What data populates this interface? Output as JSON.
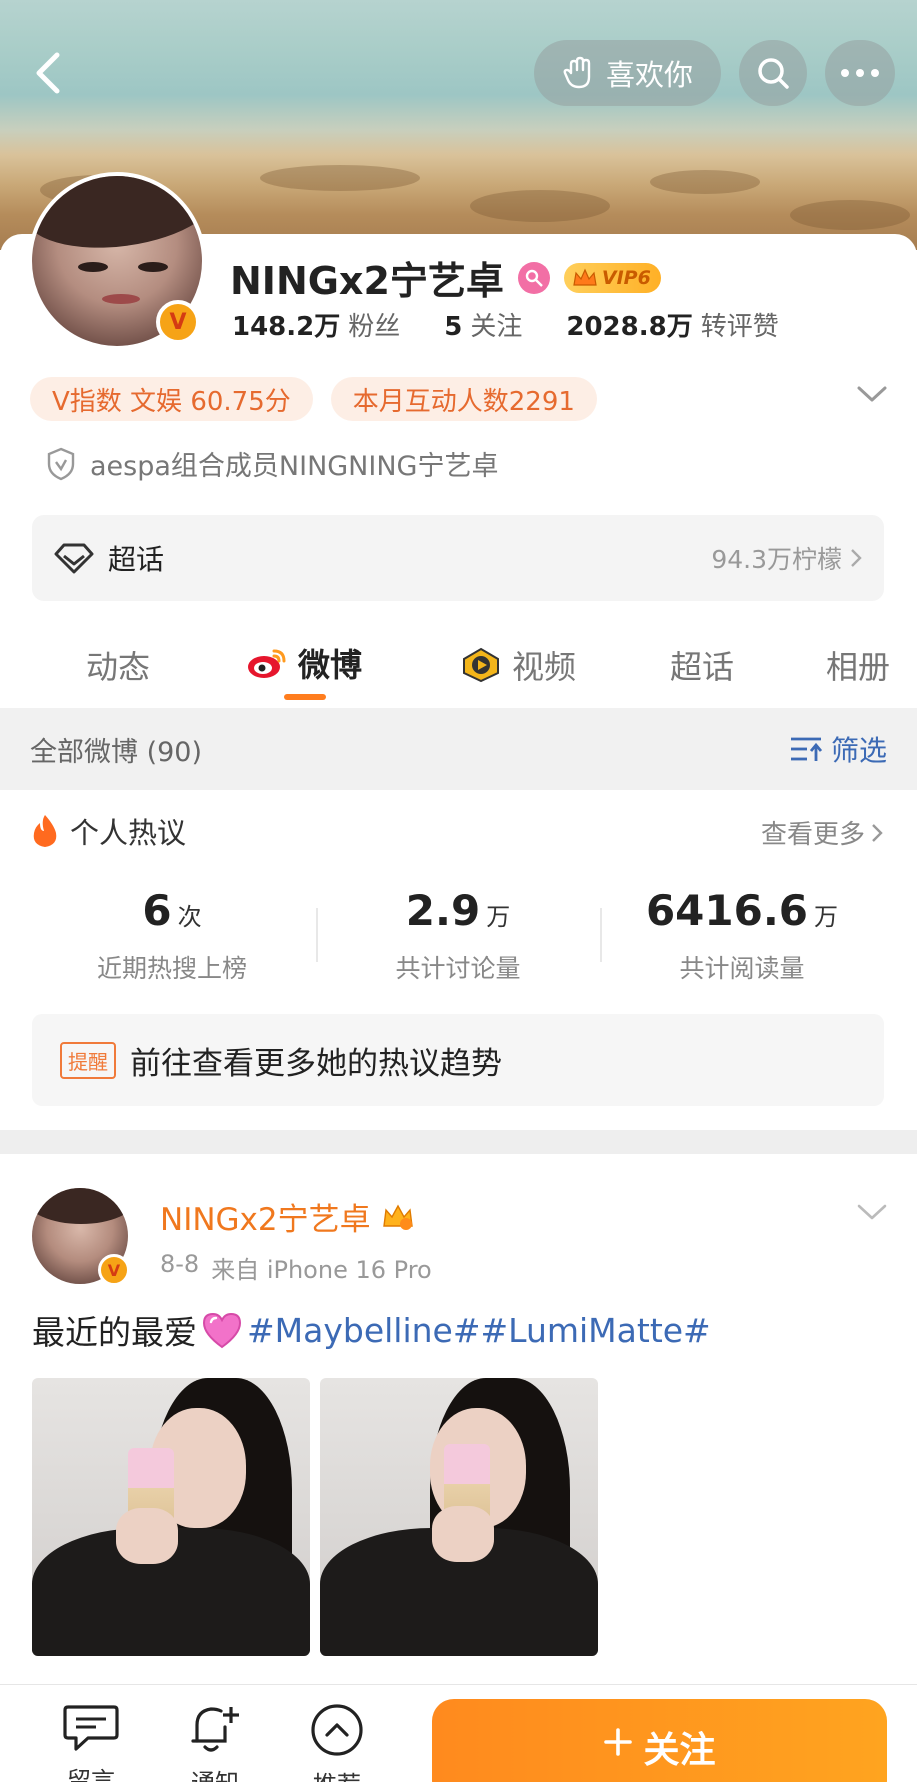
{
  "header": {
    "like_label": "喜欢你"
  },
  "profile": {
    "name": "NINGx2宁艺卓",
    "vip_label": "VIP6",
    "stats": [
      {
        "value": "148.2万",
        "label": "粉丝"
      },
      {
        "value": "5",
        "label": "关注"
      },
      {
        "value": "2028.8万",
        "label": "转评赞"
      }
    ],
    "chips": [
      "V指数 文娱 60.75分",
      "本月互动人数2291"
    ],
    "certification": "aespa组合成员NINGNING宁艺卓",
    "supertopic": {
      "label": "超话",
      "count": "94.3万柠檬"
    }
  },
  "tabs": [
    {
      "label": "动态",
      "active": false
    },
    {
      "label": "微博",
      "active": true
    },
    {
      "label": "视频",
      "active": false
    },
    {
      "label": "超话",
      "active": false
    },
    {
      "label": "相册",
      "active": false
    }
  ],
  "filter_bar": {
    "all_label": "全部微博 (90)",
    "filter_label": "筛选"
  },
  "hot": {
    "title": "个人热议",
    "more_label": "查看更多",
    "stats": [
      {
        "num": "6",
        "unit": "次",
        "label": "近期热搜上榜"
      },
      {
        "num": "2.9",
        "unit": "万",
        "label": "共计讨论量"
      },
      {
        "num": "6416.6",
        "unit": "万",
        "label": "共计阅读量"
      }
    ],
    "reminder_tag": "提醒",
    "reminder_text": "前往查看更多她的热议趋势"
  },
  "post": {
    "author": "NINGx2宁艺卓",
    "date": "8-8",
    "source": "来自 iPhone 16 Pro",
    "text": "最近的最爱",
    "hashtags": "#Maybelline##LumiMatte#"
  },
  "bottom_bar": {
    "items": [
      "留言",
      "通知",
      "推荐"
    ],
    "follow_label": "关注"
  },
  "colors": {
    "accent": "#ff7d1e",
    "link_blue": "#3c6ab5",
    "chip_bg": "#fdeee5"
  }
}
